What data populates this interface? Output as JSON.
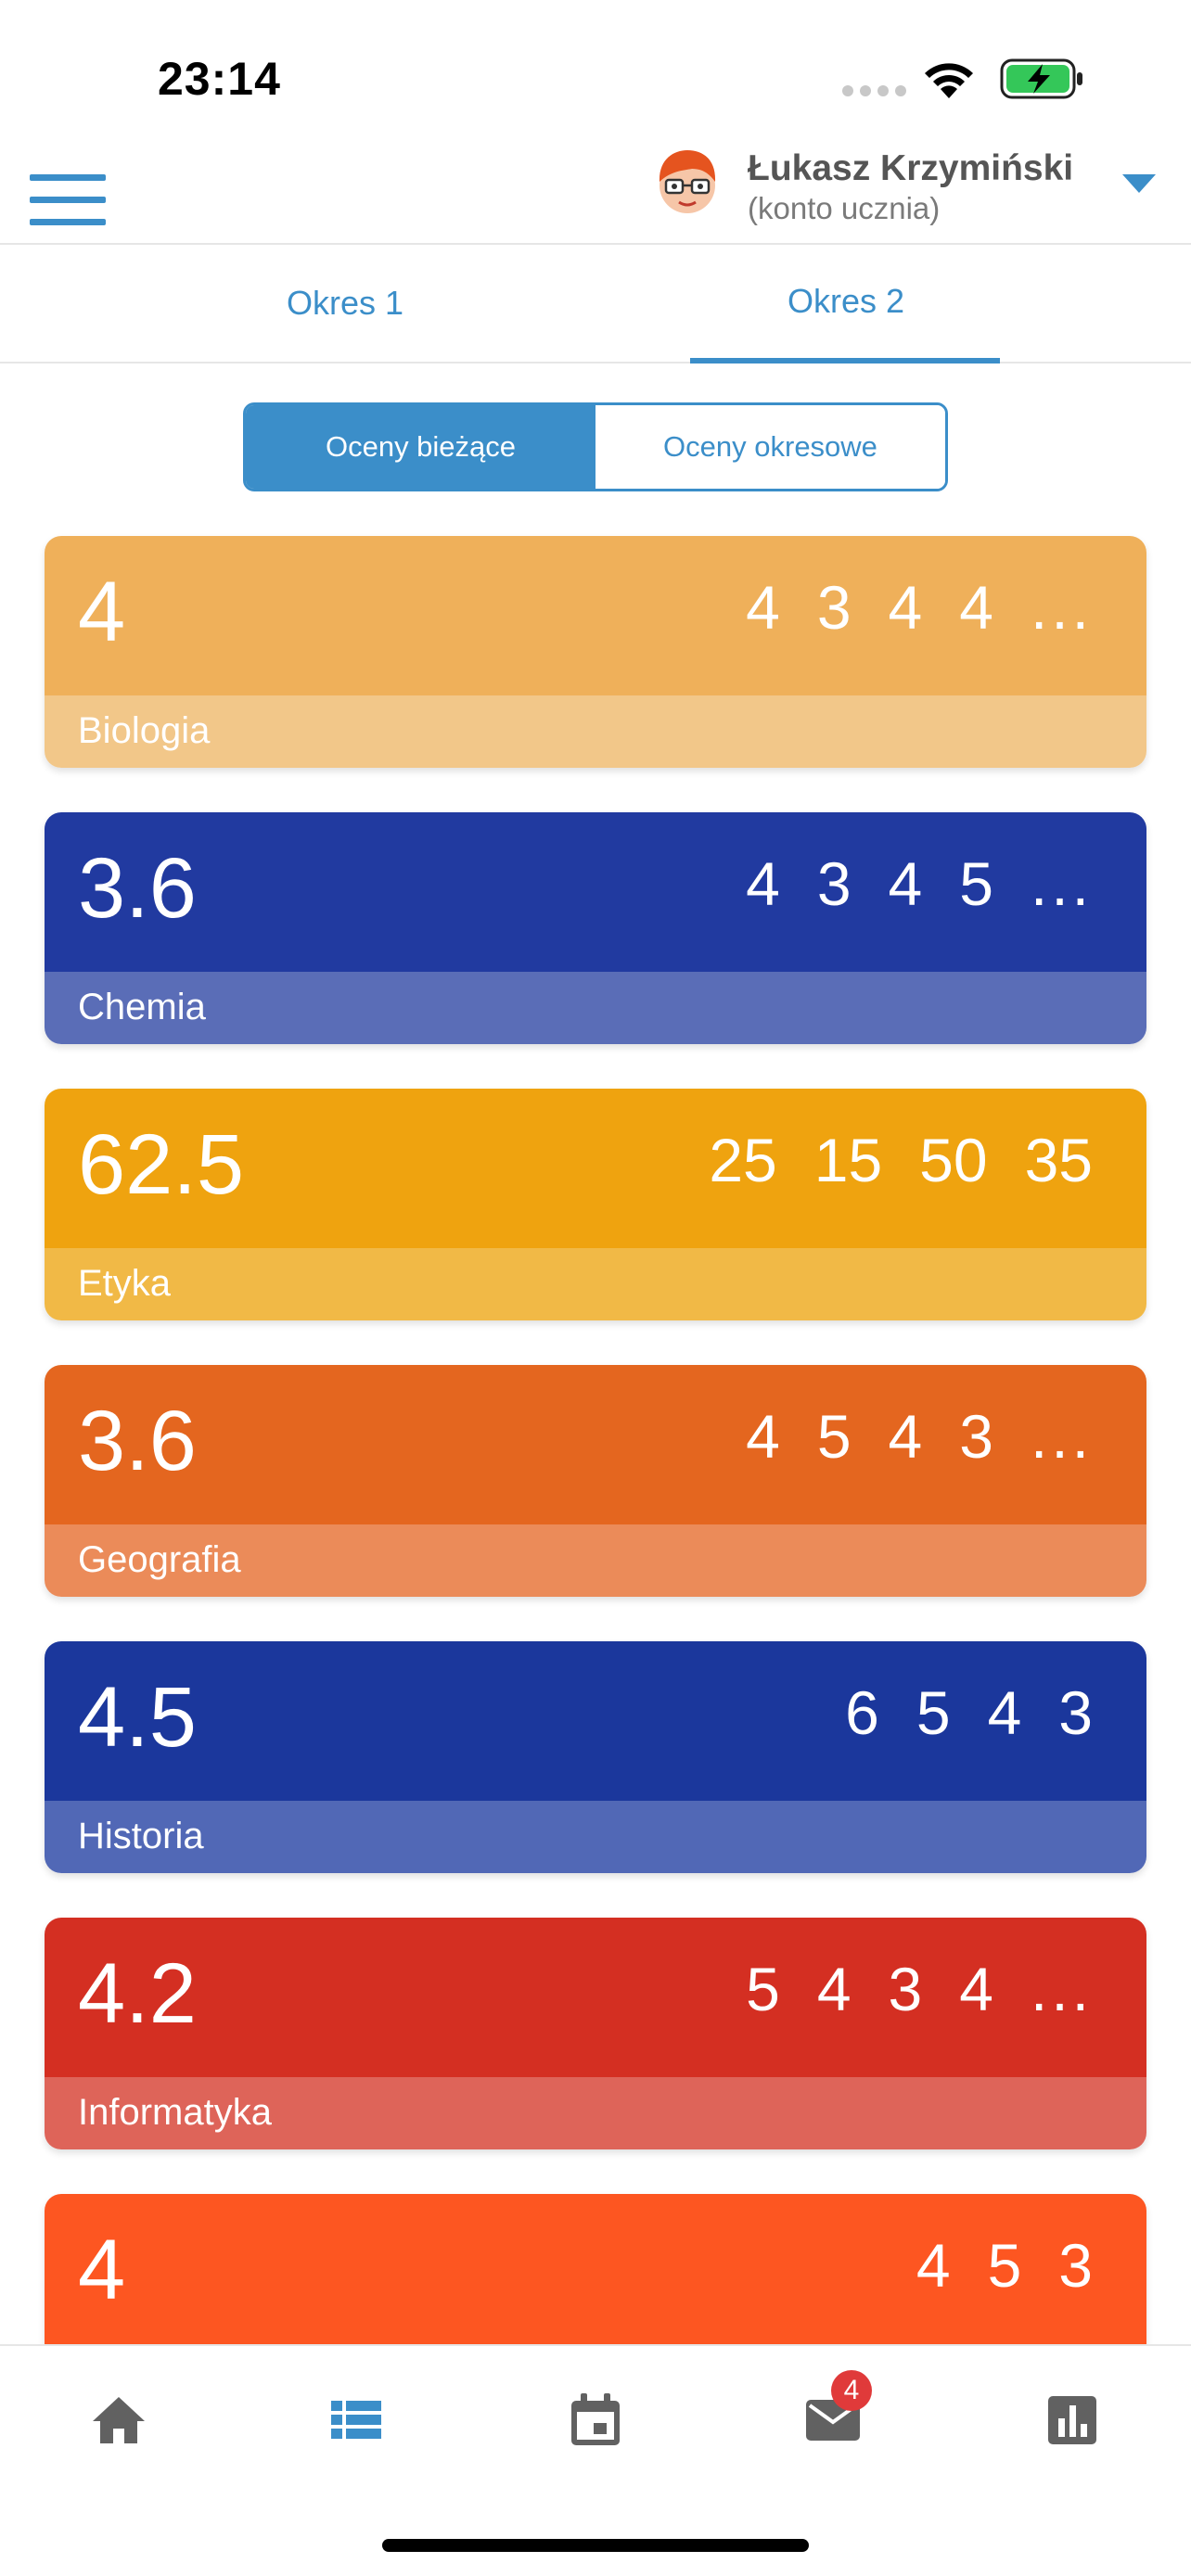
{
  "status_bar": {
    "time": "23:14"
  },
  "header": {
    "user_name": "Łukasz Krzymiński",
    "user_role": "(konto ucznia)"
  },
  "tabs": [
    {
      "label": "Okres 1"
    },
    {
      "label": "Okres 2",
      "active": true
    }
  ],
  "segment": {
    "current": "Oceny bieżące",
    "final": "Oceny okresowe",
    "selected": "Oceny bieżące"
  },
  "subjects": [
    {
      "name": "Biologia",
      "average": "4",
      "grades": [
        "4",
        "3",
        "4",
        "4"
      ],
      "more": "...",
      "color_top": "#efb05a",
      "color_bottom": "#f2c789"
    },
    {
      "name": "Chemia",
      "average": "3.6",
      "grades": [
        "4",
        "3",
        "4",
        "5"
      ],
      "more": "...",
      "color_top": "#213aa0",
      "color_bottom": "#5a6db7"
    },
    {
      "name": "Etyka",
      "average": "62.5",
      "grades": [
        "25",
        "15",
        "50",
        "35"
      ],
      "more": "",
      "color_top": "#efa30f",
      "color_bottom": "#f1b946"
    },
    {
      "name": "Geografia",
      "average": "3.6",
      "grades": [
        "4",
        "5",
        "4",
        "3"
      ],
      "more": "...",
      "color_top": "#e4661f",
      "color_bottom": "#eb8b59"
    },
    {
      "name": "Historia",
      "average": "4.5",
      "grades": [
        "6",
        "5",
        "4",
        "3"
      ],
      "more": "",
      "color_top": "#1b379c",
      "color_bottom": "#5168b6"
    },
    {
      "name": "Informatyka",
      "average": "4.2",
      "grades": [
        "5",
        "4",
        "3",
        "4"
      ],
      "more": "...",
      "color_top": "#d42f22",
      "color_bottom": "#de6459"
    },
    {
      "name": "",
      "average": "4",
      "grades": [
        "4",
        "5",
        "3"
      ],
      "more": "",
      "color_top": "#fd5621",
      "color_bottom": "#fd7f55"
    }
  ],
  "bottom_nav": {
    "items": [
      {
        "icon": "home-icon"
      },
      {
        "icon": "grades-list-icon",
        "active": true
      },
      {
        "icon": "calendar-icon"
      },
      {
        "icon": "mail-icon",
        "badge": "4"
      },
      {
        "icon": "stats-icon"
      }
    ]
  },
  "colors": {
    "accent": "#3b8ec9",
    "nav_inactive": "#616161",
    "badge": "#e03a3a"
  }
}
